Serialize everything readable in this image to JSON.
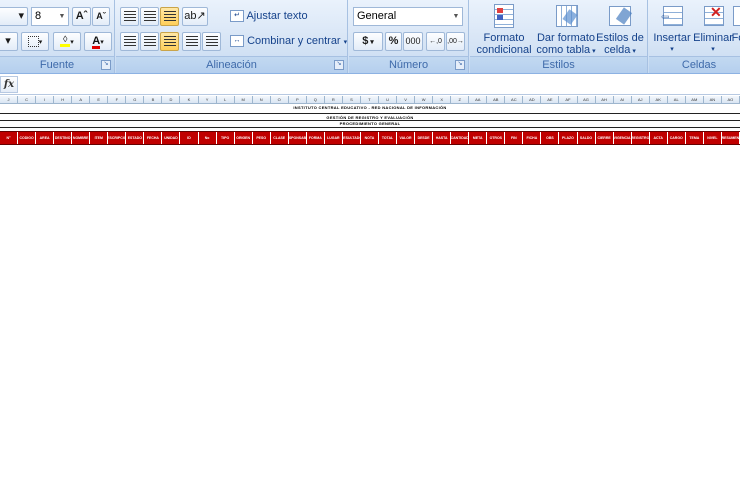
{
  "ribbon": {
    "font": {
      "size_value": "8",
      "grow_label": "Aˆ",
      "shrink_label": "Aˇ",
      "group_label": "Fuente"
    },
    "alignment": {
      "wrap_text_label": "Ajustar texto",
      "merge_center_label": "Combinar y centrar",
      "group_label": "Alineación"
    },
    "number": {
      "format_value": "General",
      "currency_label": "$",
      "percent_label": "%",
      "thousands_label": "000",
      "increase_decimal_label": "←,0",
      "decrease_decimal_label": ",00→",
      "group_label": "Número"
    },
    "styles": {
      "conditional_format_label_1": "Formato",
      "conditional_format_label_2": "condicional",
      "format_table_label_1": "Dar formato",
      "format_table_label_2": "como tabla",
      "cell_styles_label_1": "Estilos de",
      "cell_styles_label_2": "celda",
      "group_label": "Estilos"
    },
    "cells": {
      "insert_label": "Insertar",
      "delete_label": "Eliminar",
      "format_label": "Fo",
      "group_label": "Celdas"
    }
  },
  "formula_bar": {
    "fx_label": "fx",
    "value": ""
  },
  "sheet": {
    "title_line_1": "INSTITUTO CENTRAL EDUCATIVO - RED NACIONAL DE INFORMACIÓN",
    "title_line_2": "GESTIÓN DE REGISTRO Y EVALUACIÓN",
    "title_line_3": "PROCEDIMIENTO GENERAL",
    "column_letters": [
      "J",
      "C",
      "I",
      "H",
      "A",
      "E",
      "F",
      "G",
      "B",
      "D",
      "K",
      "Y",
      "L",
      "M",
      "N",
      "O",
      "P",
      "Q",
      "R",
      "S",
      "T",
      "U",
      "V",
      "W",
      "X",
      "Z",
      "AA",
      "AB",
      "AC",
      "AD",
      "AE",
      "AF",
      "AG",
      "AH",
      "AI",
      "AJ",
      "AK",
      "AL",
      "AM",
      "AN",
      "AO"
    ],
    "header_cells": [
      "N°",
      "CODIGO",
      "AREA",
      "DESTINO",
      "NOMBRE",
      "ITEM",
      "DESCRIPCION",
      "ESTADO",
      "FECHA",
      "UNIDAD",
      "ID",
      "No",
      "TIPO",
      "ORIGEN",
      "PESO",
      "CLASE",
      "RESPONSABLE",
      "FORMA",
      "LUGAR",
      "RESULTADO",
      "NOTA",
      "TOTAL",
      "VALOR",
      "DESDE",
      "HASTA",
      "CANTIDAD",
      "META",
      "OTROS",
      "FIN",
      "FICHA",
      "OBS",
      "PLAZO",
      "SALDO",
      "CIERRE",
      "VIGENCIA",
      "REGISTRO",
      "ACTA",
      "CARGO",
      "TEMA",
      "NIVEL",
      "RESUMEN"
    ]
  }
}
